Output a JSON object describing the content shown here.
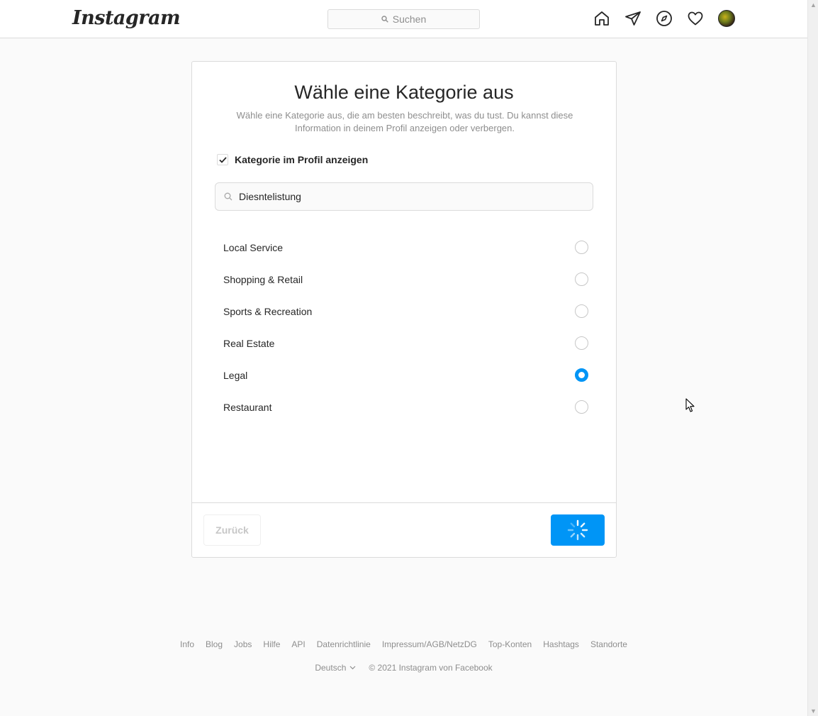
{
  "header": {
    "logo": "Instagram",
    "search_placeholder": "Suchen",
    "icons": [
      "home-icon",
      "direct-icon",
      "explore-icon",
      "activity-heart-icon",
      "profile-avatar"
    ]
  },
  "card": {
    "title": "Wähle eine Kategorie aus",
    "subtitle": "Wähle eine Kategorie aus, die am besten beschreibt, was du tust. Du kannst diese Information in deinem Profil anzeigen oder verbergen.",
    "show_category_label": "Kategorie im Profil anzeigen",
    "show_category_checked": true,
    "search_value": "Diesntelistung",
    "options": [
      {
        "label": "Local Service",
        "selected": false
      },
      {
        "label": "Shopping & Retail",
        "selected": false
      },
      {
        "label": "Sports & Recreation",
        "selected": false
      },
      {
        "label": "Real Estate",
        "selected": false
      },
      {
        "label": "Legal",
        "selected": true
      },
      {
        "label": "Restaurant",
        "selected": false
      }
    ],
    "back_label": "Zurück",
    "next_state": "loading"
  },
  "footer": {
    "links": [
      "Info",
      "Blog",
      "Jobs",
      "Hilfe",
      "API",
      "Datenrichtlinie",
      "Impressum/AGB/NetzDG",
      "Top-Konten",
      "Hashtags",
      "Standorte"
    ],
    "language": "Deutsch",
    "copyright": "© 2021 Instagram von Facebook"
  },
  "colors": {
    "accent": "#0095f6",
    "border": "#dbdbdb",
    "muted_text": "#8e8e8e",
    "background": "#fafafa"
  }
}
